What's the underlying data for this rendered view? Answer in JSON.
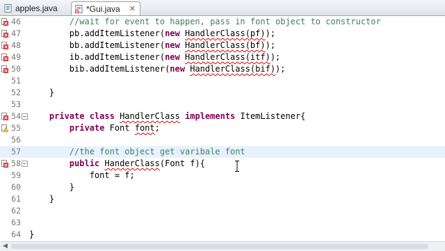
{
  "tabs": [
    {
      "label": "apples.java",
      "active": false,
      "dirty": false
    },
    {
      "label": "*Gui.java",
      "active": true,
      "dirty": true,
      "close_icon": "close-icon"
    }
  ],
  "colors": {
    "keyword": "#7f0055",
    "comment": "#3f7f5f",
    "error_underline": "#e00000",
    "current_line": "#e8f2fe"
  },
  "lines": [
    {
      "num": "46",
      "marker": "error",
      "tokens": [
        {
          "t": "        ",
          "c": ""
        },
        {
          "t": "//wait for event to happen, pass in font object to constructor",
          "c": "cm"
        }
      ]
    },
    {
      "num": "47",
      "marker": "error",
      "tokens": [
        {
          "t": "        pb.addItemListener(",
          "c": ""
        },
        {
          "t": "new",
          "c": "kw"
        },
        {
          "t": " ",
          "c": ""
        },
        {
          "t": "HandlerClass(pf)",
          "c": "err"
        },
        {
          "t": ");",
          "c": ""
        }
      ]
    },
    {
      "num": "48",
      "marker": "error",
      "tokens": [
        {
          "t": "        bb.addItemListener(",
          "c": ""
        },
        {
          "t": "new",
          "c": "kw"
        },
        {
          "t": " ",
          "c": ""
        },
        {
          "t": "HandlerClass(bf)",
          "c": "err"
        },
        {
          "t": ");",
          "c": ""
        }
      ]
    },
    {
      "num": "49",
      "marker": "error",
      "tokens": [
        {
          "t": "        ib.addItemListener(",
          "c": ""
        },
        {
          "t": "new",
          "c": "kw"
        },
        {
          "t": " ",
          "c": ""
        },
        {
          "t": "HandlerClass(itf)",
          "c": "err"
        },
        {
          "t": ");",
          "c": ""
        }
      ]
    },
    {
      "num": "50",
      "marker": "error",
      "tokens": [
        {
          "t": "        bib.addItemListener(",
          "c": ""
        },
        {
          "t": "new",
          "c": "kw"
        },
        {
          "t": " ",
          "c": ""
        },
        {
          "t": "HandlerClass(bif)",
          "c": "err"
        },
        {
          "t": ");",
          "c": ""
        }
      ]
    },
    {
      "num": "51",
      "marker": "",
      "tokens": []
    },
    {
      "num": "52",
      "marker": "",
      "tokens": [
        {
          "t": "    }",
          "c": ""
        }
      ]
    },
    {
      "num": "53",
      "marker": "",
      "tokens": []
    },
    {
      "num": "54",
      "marker": "error",
      "fold": "−",
      "tokens": [
        {
          "t": "    ",
          "c": ""
        },
        {
          "t": "private",
          "c": "kw"
        },
        {
          "t": " ",
          "c": ""
        },
        {
          "t": "class",
          "c": "kw"
        },
        {
          "t": " ",
          "c": ""
        },
        {
          "t": "HandlerClass",
          "c": "err"
        },
        {
          "t": " ",
          "c": ""
        },
        {
          "t": "implements",
          "c": "kw"
        },
        {
          "t": " ItemListener{",
          "c": ""
        }
      ]
    },
    {
      "num": "55",
      "marker": "warning",
      "tokens": [
        {
          "t": "        ",
          "c": ""
        },
        {
          "t": "private",
          "c": "kw"
        },
        {
          "t": " Font ",
          "c": ""
        },
        {
          "t": "font",
          "c": "err"
        },
        {
          "t": ";",
          "c": ""
        }
      ]
    },
    {
      "num": "56",
      "marker": "",
      "tokens": []
    },
    {
      "num": "57",
      "marker": "",
      "current": true,
      "tokens": [
        {
          "t": "        ",
          "c": ""
        },
        {
          "t": "//the font object get varibale font",
          "c": "cm"
        }
      ]
    },
    {
      "num": "58",
      "marker": "error",
      "fold": "−",
      "tokens": [
        {
          "t": "        ",
          "c": ""
        },
        {
          "t": "public",
          "c": "kw"
        },
        {
          "t": " ",
          "c": ""
        },
        {
          "t": "HanderClass",
          "c": "err"
        },
        {
          "t": "(Font f){",
          "c": ""
        }
      ]
    },
    {
      "num": "59",
      "marker": "",
      "tokens": [
        {
          "t": "            font = f;",
          "c": ""
        }
      ]
    },
    {
      "num": "60",
      "marker": "",
      "tokens": [
        {
          "t": "        }",
          "c": ""
        }
      ]
    },
    {
      "num": "61",
      "marker": "",
      "tokens": [
        {
          "t": "    }",
          "c": ""
        }
      ]
    },
    {
      "num": "62",
      "marker": "",
      "tokens": []
    },
    {
      "num": "63",
      "marker": "",
      "tokens": []
    },
    {
      "num": "64",
      "marker": "",
      "tokens": [
        {
          "t": "}",
          "c": ""
        }
      ]
    }
  ],
  "scrollbar": {
    "left_arrow_icon": "scroll-left-arrow-icon"
  },
  "pointer": {
    "icon": "text-cursor-ibeam-icon"
  }
}
